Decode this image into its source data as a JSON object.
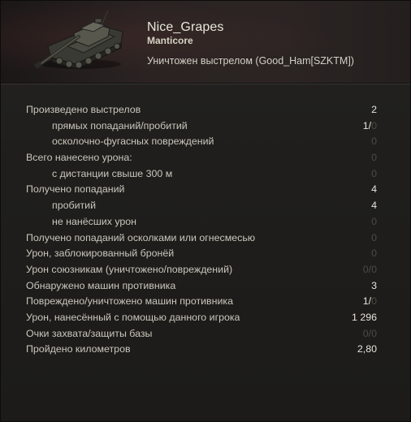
{
  "header": {
    "player_name": "Nice_Grapes",
    "vehicle_name": "Manticore",
    "death_reason": "Уничтожен выстрелом (Good_Ham[SZKTM])",
    "tank_icon": "light-tank-icon"
  },
  "stats": {
    "rows": [
      {
        "label": "Произведено выстрелов",
        "value": "2",
        "sub": false,
        "dim": false
      },
      {
        "label": "прямых попаданий/пробитий",
        "value_main": "1/",
        "value_dim": "0",
        "sub": true,
        "split": true
      },
      {
        "label": "осколочно-фугасных повреждений",
        "value": "0",
        "sub": true,
        "dim": true
      },
      {
        "label": "Всего нанесено урона:",
        "value": "0",
        "sub": false,
        "dim": true
      },
      {
        "label": "с дистанции свыше 300 м",
        "value": "0",
        "sub": true,
        "dim": true
      },
      {
        "label": "Получено попаданий",
        "value": "4",
        "sub": false,
        "dim": false
      },
      {
        "label": "пробитий",
        "value": "4",
        "sub": true,
        "dim": false
      },
      {
        "label": "не нанёсших урон",
        "value": "0",
        "sub": true,
        "dim": true
      },
      {
        "label": "Получено попаданий осколками или огнесмесью",
        "value": "0",
        "sub": false,
        "dim": true
      },
      {
        "label": "Урон, заблокированный бронёй",
        "value": "0",
        "sub": false,
        "dim": true
      },
      {
        "label": "Урон союзникам (уничтожено/повреждений)",
        "value": "0/0",
        "sub": false,
        "dim": true
      },
      {
        "label": "Обнаружено машин противника",
        "value": "3",
        "sub": false,
        "dim": false
      },
      {
        "label": "Повреждено/уничтожено машин противника",
        "value_main": "1/",
        "value_dim": "0",
        "sub": false,
        "split": true
      },
      {
        "label": "Урон, нанесённый с помощью данного игрока",
        "value": "1 296",
        "sub": false,
        "dim": false
      },
      {
        "label": "Очки захвата/защиты базы",
        "value": "0/0",
        "sub": false,
        "dim": true
      },
      {
        "label": "Пройдено километров",
        "value": "2,80",
        "sub": false,
        "dim": false
      }
    ]
  },
  "colors": {
    "value_active": "#e6e4da",
    "value_dim": "#4b4a45",
    "header_bg": "#2a2322"
  }
}
